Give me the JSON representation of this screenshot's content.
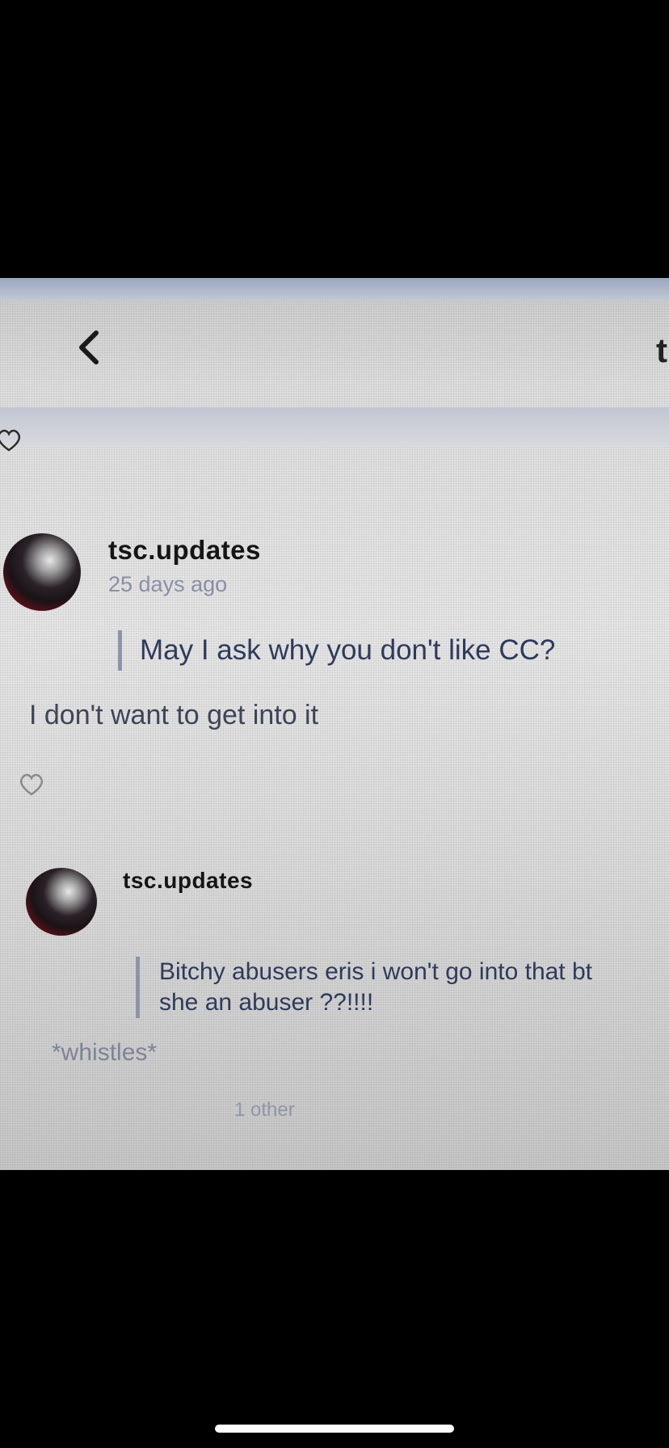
{
  "header": {
    "back_icon": "chevron-left-icon",
    "edge_letter": "t"
  },
  "comments": [
    {
      "username": "tsc.updates",
      "timestamp": "25 days ago",
      "quote": "May I ask why you don't like CC?",
      "body": "I don't want to get into it",
      "like_icon": "heart-outline-icon"
    },
    {
      "username": "tsc.updates",
      "timestamp": "",
      "quote_line1": "Bitchy abusers eris i won't go into that bt",
      "quote_line2": "she an abuser ??!!!!",
      "body": "*whistles*",
      "likes_text": "1 other",
      "like_icon": "heart-outline-icon"
    }
  ],
  "colors": {
    "screen_background": "#e0e0e0",
    "header_band": "#c4c9d4",
    "username": "#151515",
    "timestamp": "#8a8fa6",
    "quote_bar": "#8d93a8",
    "quote_text": "#2f3a5c"
  }
}
